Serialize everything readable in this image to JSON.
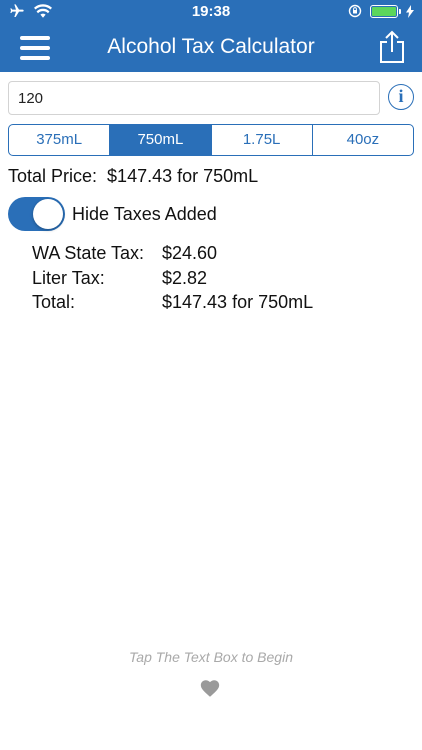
{
  "status_bar": {
    "time": "19:38",
    "icons": [
      "airplane-icon",
      "wifi-icon",
      "orientation-lock-icon",
      "battery-icon",
      "charging-bolt-icon"
    ]
  },
  "navbar": {
    "title": "Alcohol Tax Calculator",
    "left_icon": "hamburger-menu-icon",
    "right_icon": "share-icon"
  },
  "price_input": {
    "value": "120",
    "info_icon_label": "i"
  },
  "sizes": {
    "options": [
      "375mL",
      "750mL",
      "1.75L",
      "40oz"
    ],
    "selected": "750mL"
  },
  "total_price": {
    "label": "Total Price:",
    "value": "$147.43 for 750mL"
  },
  "hide_taxes": {
    "label": "Hide Taxes Added",
    "on": true
  },
  "taxes": [
    {
      "label": "WA State Tax:",
      "value": "$24.60"
    },
    {
      "label": "Liter Tax:",
      "value": "$2.82"
    },
    {
      "label": "Total:",
      "value": "$147.43 for 750mL"
    }
  ],
  "footer": {
    "hint": "Tap The Text Box to Begin",
    "icon": "heart-icon"
  },
  "colors": {
    "accent": "#2a6fb8",
    "battery": "#5cd65c",
    "hint_text": "#a9a9a9"
  }
}
